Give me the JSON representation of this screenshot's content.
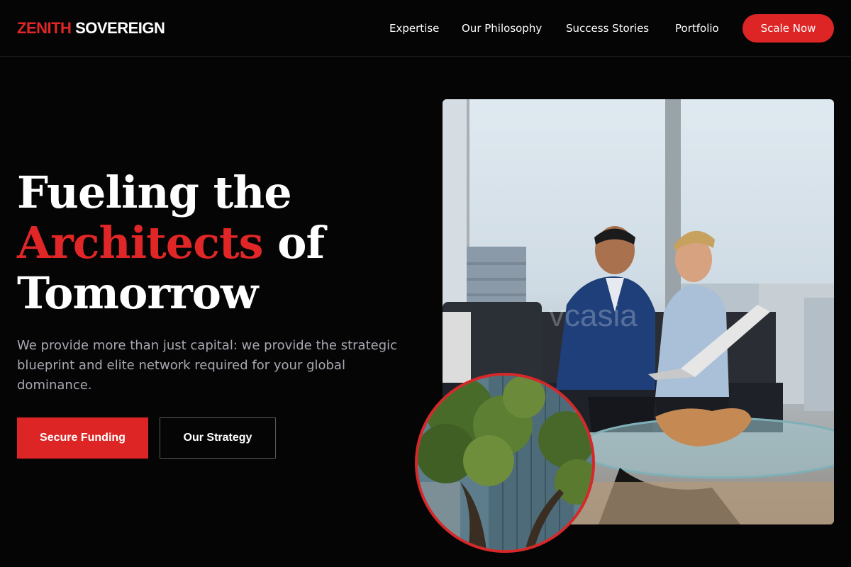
{
  "brand": {
    "part1": "ZENITH",
    "part2": "SOVEREIGN",
    "accent_color": "#e02626"
  },
  "nav": {
    "links": [
      "Expertise",
      "Our Philosophy",
      "Success Stories",
      "Portfolio"
    ],
    "cta_label": "Scale Now"
  },
  "hero": {
    "title_line1": "Fueling the",
    "title_accent": "Architects",
    "title_of": "of",
    "title_line3": "Tomorrow",
    "subtitle": "We provide more than just capital: we provide the strategic blueprint and elite network required for your global dominance.",
    "primary_button": "Secure Funding",
    "secondary_button": "Our Strategy"
  },
  "images": {
    "main_photo_watermark": "vcasia"
  }
}
